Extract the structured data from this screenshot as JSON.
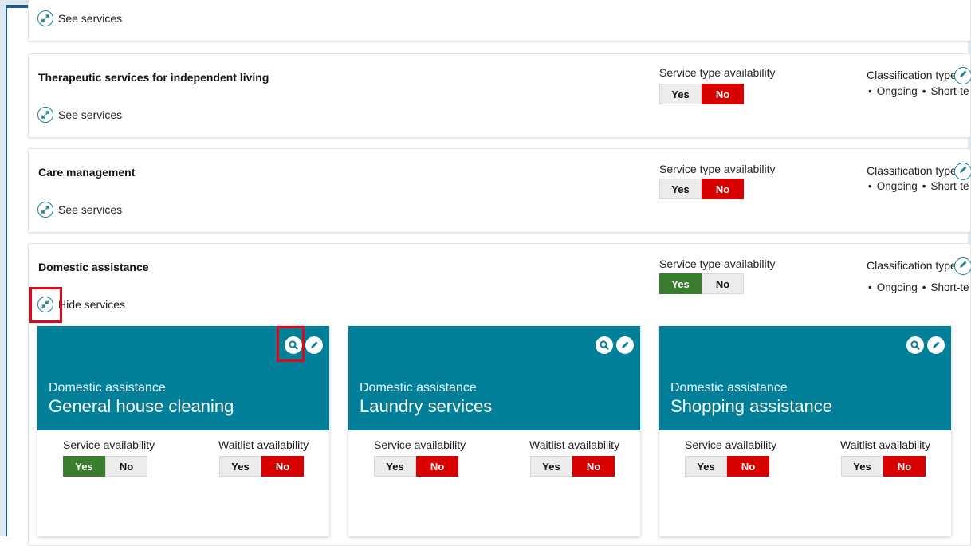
{
  "sections": [
    {
      "title": "",
      "link": "See services"
    },
    {
      "title": "Therapeutic services for independent living",
      "link": "See services",
      "availability_label": "Service type availability",
      "yes": "Yes",
      "no": "No",
      "selected": "No",
      "classification_label": "Classification type",
      "classifications": [
        "Ongoing",
        "Short-te"
      ]
    },
    {
      "title": "Care management",
      "link": "See services",
      "availability_label": "Service type availability",
      "yes": "Yes",
      "no": "No",
      "selected": "No",
      "classification_label": "Classification type",
      "classifications": [
        "Ongoing",
        "Short-te"
      ]
    },
    {
      "title": "Domestic assistance",
      "link": "Hide services",
      "availability_label": "Service type availability",
      "yes": "Yes",
      "no": "No",
      "selected": "Yes",
      "classification_label": "Classification type",
      "classifications": [
        "Ongoing",
        "Short-te"
      ]
    }
  ],
  "service_cards": [
    {
      "category": "Domestic assistance",
      "name": "General house cleaning",
      "service_label": "Service availability",
      "service_selected": "Yes",
      "waitlist_label": "Waitlist availability",
      "waitlist_selected": "No",
      "yes": "Yes",
      "no": "No"
    },
    {
      "category": "Domestic assistance",
      "name": "Laundry services",
      "service_label": "Service availability",
      "service_selected": "No",
      "waitlist_label": "Waitlist availability",
      "waitlist_selected": "No",
      "yes": "Yes",
      "no": "No"
    },
    {
      "category": "Domestic assistance",
      "name": "Shopping assistance",
      "service_label": "Service availability",
      "service_selected": "No",
      "waitlist_label": "Waitlist availability",
      "waitlist_selected": "No",
      "yes": "Yes",
      "no": "No"
    }
  ],
  "colors": {
    "teal": "#027f99",
    "red": "#d90000",
    "green": "#3a7d2f",
    "highlight": "#e2061b"
  },
  "icons": [
    "expand-icon",
    "collapse-icon",
    "pencil-icon",
    "magnify-icon"
  ]
}
